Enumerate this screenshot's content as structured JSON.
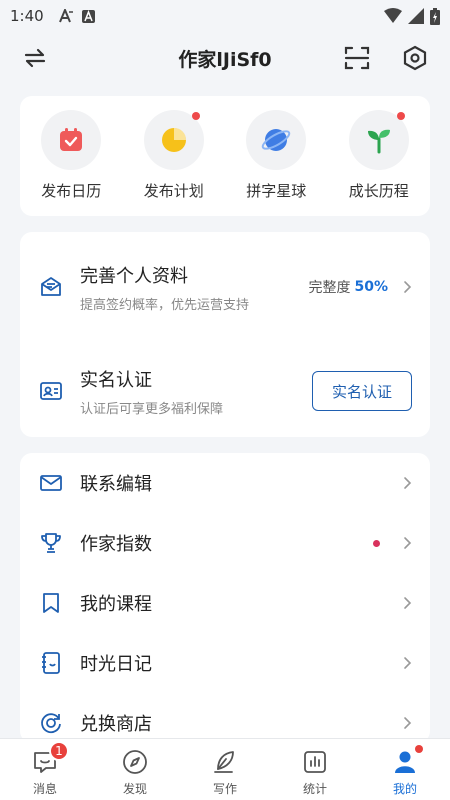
{
  "status_bar": {
    "time": "1:40"
  },
  "header": {
    "title": "作家lJiSf0"
  },
  "shortcuts": [
    {
      "label": "发布日历",
      "icon": "calendar-icon",
      "has_dot": false
    },
    {
      "label": "发布计划",
      "icon": "pie-chart-icon",
      "has_dot": true
    },
    {
      "label": "拼字星球",
      "icon": "planet-icon",
      "has_dot": false
    },
    {
      "label": "成长历程",
      "icon": "sprout-icon",
      "has_dot": true
    }
  ],
  "profile": {
    "title": "完善个人资料",
    "subtitle": "提高签约概率，优先运营支持",
    "completion_label": "完整度",
    "completion_value": "50%"
  },
  "verify": {
    "title": "实名认证",
    "subtitle": "认证后可享更多福利保障",
    "button": "实名认证"
  },
  "menu": [
    {
      "label": "联系编辑",
      "icon": "mail-icon",
      "has_dot": false
    },
    {
      "label": "作家指数",
      "icon": "trophy-icon",
      "has_dot": true
    },
    {
      "label": "我的课程",
      "icon": "bookmark-icon",
      "has_dot": false
    },
    {
      "label": "时光日记",
      "icon": "notebook-icon",
      "has_dot": false
    },
    {
      "label": "兑换商店",
      "icon": "exchange-icon",
      "has_dot": false
    }
  ],
  "tabs": [
    {
      "label": "消息",
      "icon": "message-icon",
      "badge": "1",
      "active": false
    },
    {
      "label": "发现",
      "icon": "compass-icon",
      "badge": "",
      "active": false
    },
    {
      "label": "写作",
      "icon": "quill-icon",
      "badge": "",
      "active": false
    },
    {
      "label": "统计",
      "icon": "stats-icon",
      "badge": "",
      "active": false
    },
    {
      "label": "我的",
      "icon": "person-icon",
      "badge": "",
      "active": true
    }
  ],
  "colors": {
    "accent": "#1a6fd6",
    "badge": "#e8413c",
    "dot": "#d9325d"
  }
}
